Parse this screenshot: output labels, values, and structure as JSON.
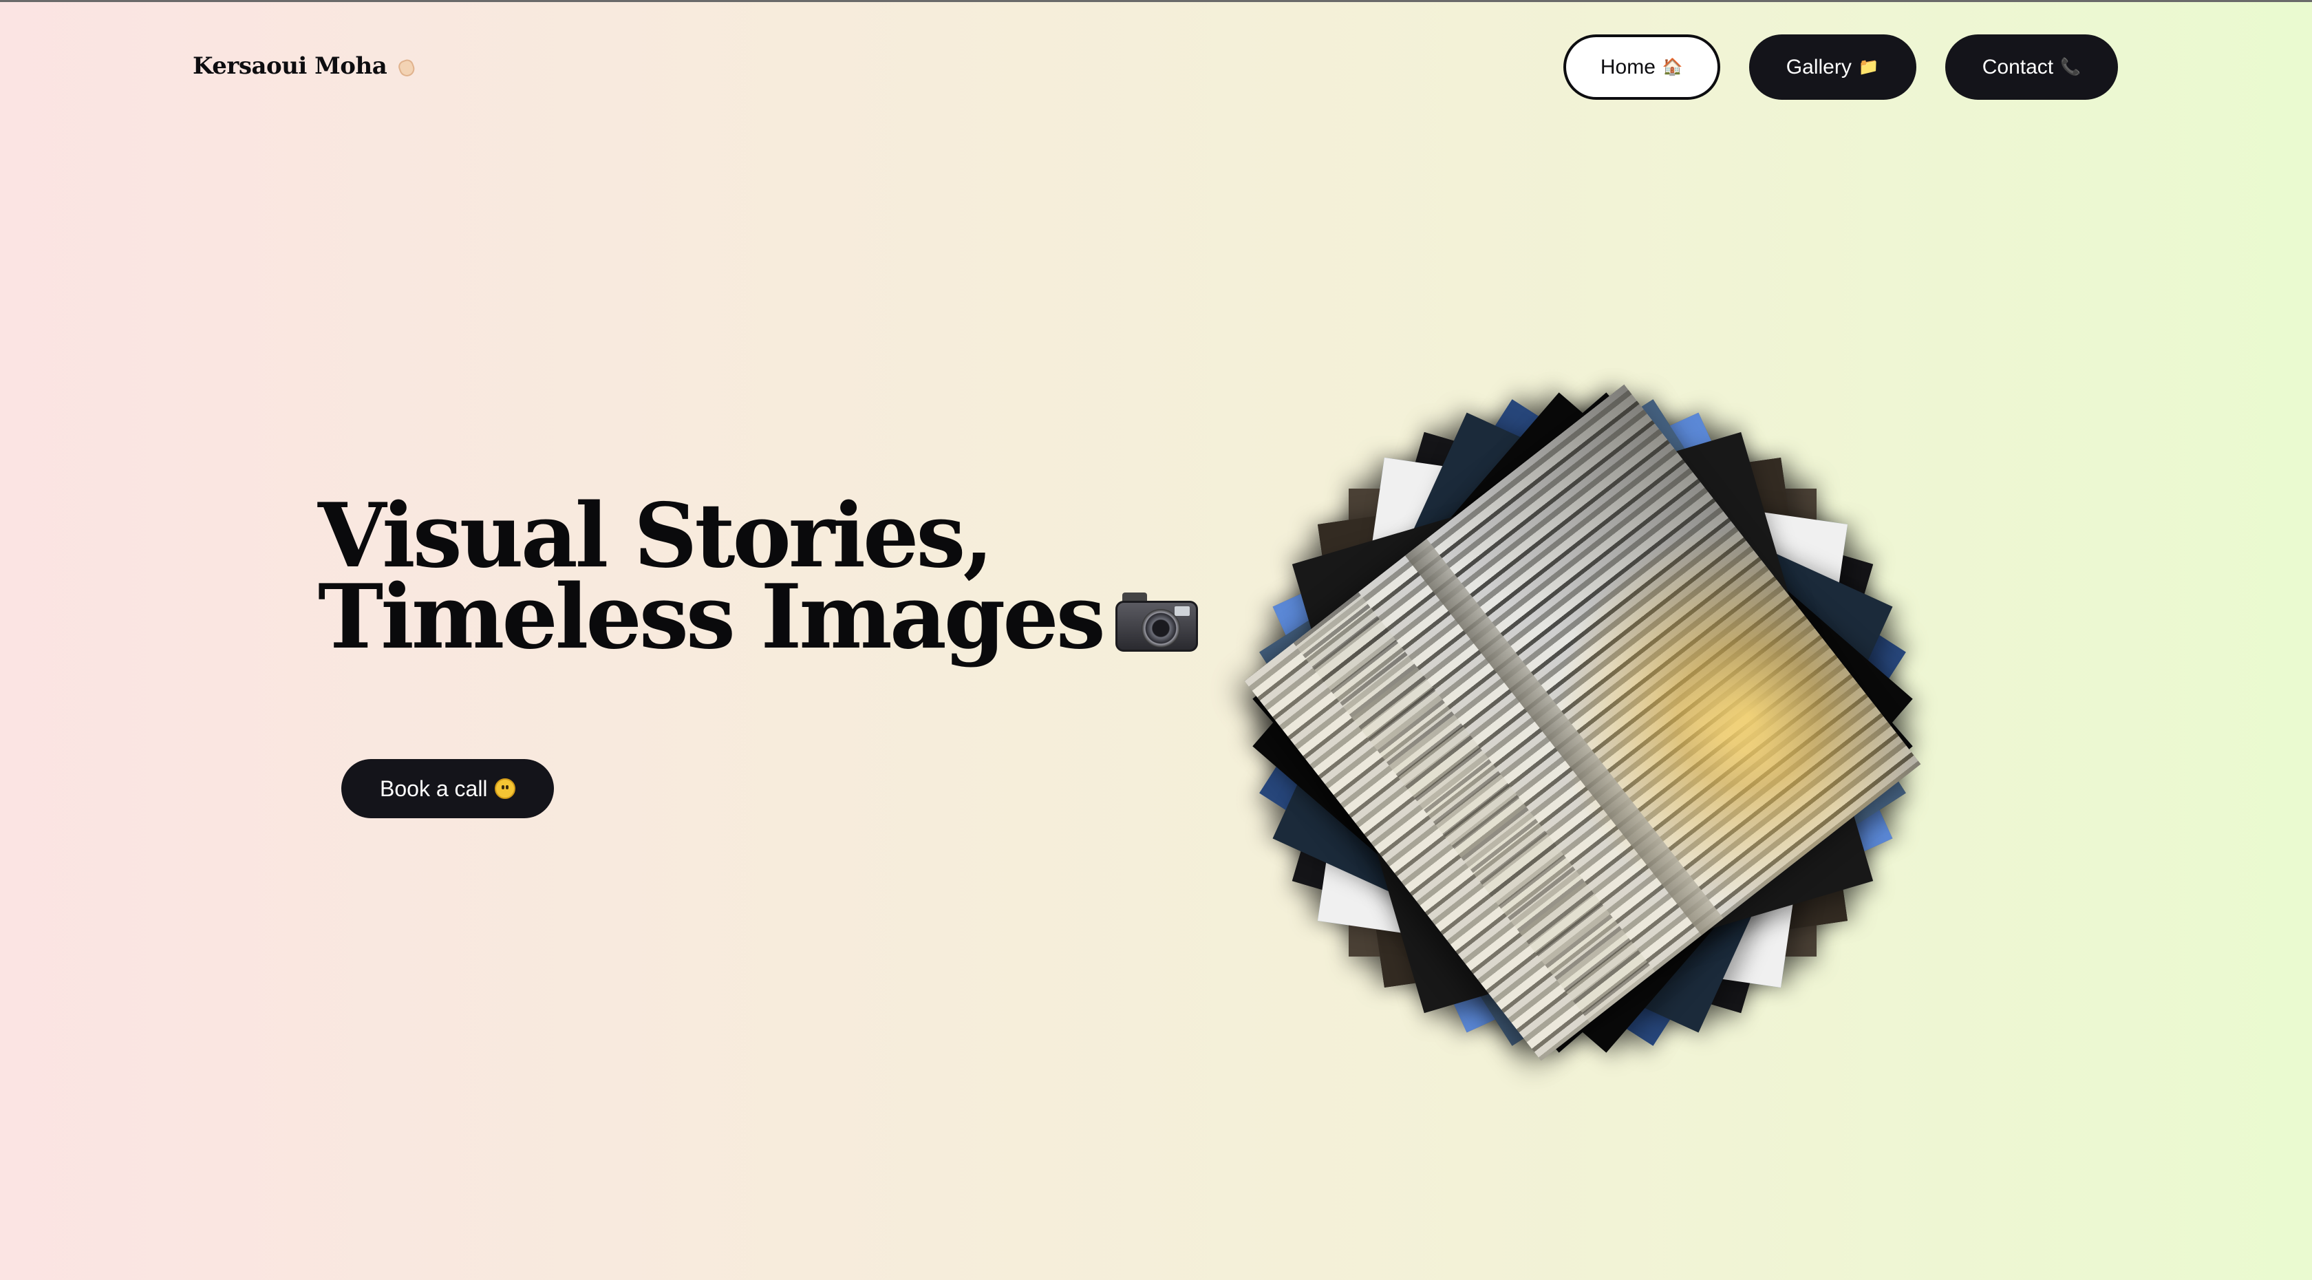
{
  "brand": {
    "name": "Kersaoui Moha",
    "icon": "waving-hand-icon"
  },
  "nav": {
    "items": [
      {
        "label": "Home",
        "icon": "house-icon",
        "glyph": "🏠",
        "active": true
      },
      {
        "label": "Gallery",
        "icon": "folder-icon",
        "glyph": "📁",
        "active": false
      },
      {
        "label": "Contact",
        "icon": "phone-icon",
        "glyph": "📞",
        "active": false
      }
    ]
  },
  "hero": {
    "line1": "Visual Stories,",
    "line2": "Timeless Images",
    "icon": "camera-icon",
    "cta_label": "Book a call",
    "cta_icon": "grinning-face-icon"
  },
  "gallery_stack": {
    "description_icon": "photo-stack",
    "card_colors": [
      "#0c0c0e",
      "#1a1b1f",
      "#3a6fc4",
      "#2a4d7a",
      "#6f6f72",
      "#101012",
      "#7aa2e8",
      "#2b2b30",
      "#0e2233",
      "#1f3d5e",
      "#d9d9d9",
      "#4a4035",
      "#151518",
      "#27467a",
      "#0a0a0a",
      "#5b88d6",
      "#332b22",
      "#f0f0f0",
      "#1b2a3a",
      "#090909",
      "#44607f",
      "#181818"
    ]
  },
  "colors": {
    "bg_left": "#fbe4e3",
    "bg_right": "#eafad0",
    "dark_button": "#14141a",
    "text": "#0d0d10"
  }
}
